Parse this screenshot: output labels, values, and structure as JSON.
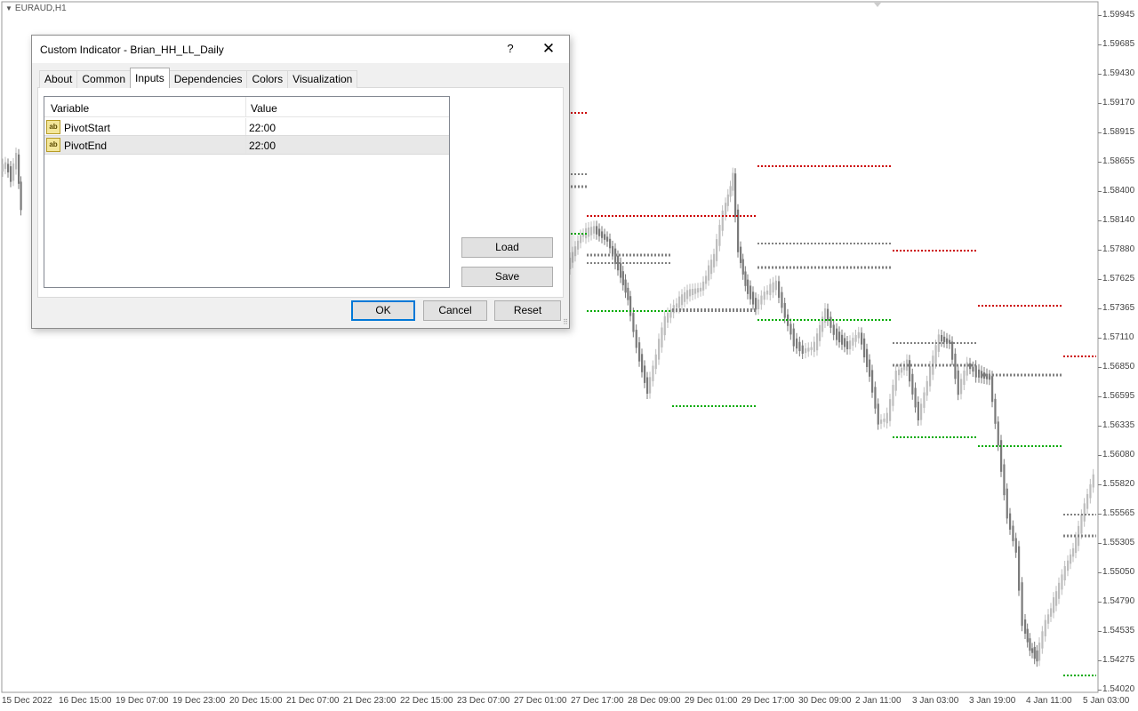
{
  "chart": {
    "symbol_title": "EURAUD,H1",
    "price_axis": [
      "1.59945",
      "1.59685",
      "1.59430",
      "1.59170",
      "1.58915",
      "1.58655",
      "1.58400",
      "1.58140",
      "1.57880",
      "1.57625",
      "1.57365",
      "1.57110",
      "1.56850",
      "1.56595",
      "1.56335",
      "1.56080",
      "1.55820",
      "1.55565",
      "1.55305",
      "1.55050",
      "1.54790",
      "1.54535",
      "1.54275",
      "1.54020"
    ],
    "time_axis": [
      "15 Dec 2022",
      "16 Dec 15:00",
      "19 Dec 07:00",
      "19 Dec 23:00",
      "20 Dec 15:00",
      "21 Dec 07:00",
      "21 Dec 23:00",
      "22 Dec 15:00",
      "23 Dec 07:00",
      "27 Dec 01:00",
      "27 Dec 17:00",
      "28 Dec 09:00",
      "29 Dec 01:00",
      "29 Dec 17:00",
      "30 Dec 09:00",
      "2 Jan 11:00",
      "3 Jan 03:00",
      "3 Jan 19:00",
      "4 Jan 11:00",
      "5 Jan 03:00"
    ],
    "colors": {
      "high_level": "#cc0000",
      "low_level": "#00aa00",
      "pivot_level": "#808080",
      "bull_candle": "#bdbdbd",
      "bear_candle": "#7a7a7a"
    }
  },
  "dialog": {
    "title": "Custom Indicator - Brian_HH_LL_Daily",
    "help_label": "?",
    "close_label": "✕",
    "tabs": [
      {
        "label": "About"
      },
      {
        "label": "Common"
      },
      {
        "label": "Inputs"
      },
      {
        "label": "Dependencies"
      },
      {
        "label": "Colors"
      },
      {
        "label": "Visualization"
      }
    ],
    "active_tab": "Inputs",
    "grid": {
      "col_variable": "Variable",
      "col_value": "Value",
      "rows": [
        {
          "icon": "ab",
          "variable": "PivotStart",
          "value": "22:00"
        },
        {
          "icon": "ab",
          "variable": "PivotEnd",
          "value": "22:00"
        }
      ]
    },
    "load_label": "Load",
    "save_label": "Save",
    "ok_label": "OK",
    "cancel_label": "Cancel",
    "reset_label": "Reset"
  }
}
